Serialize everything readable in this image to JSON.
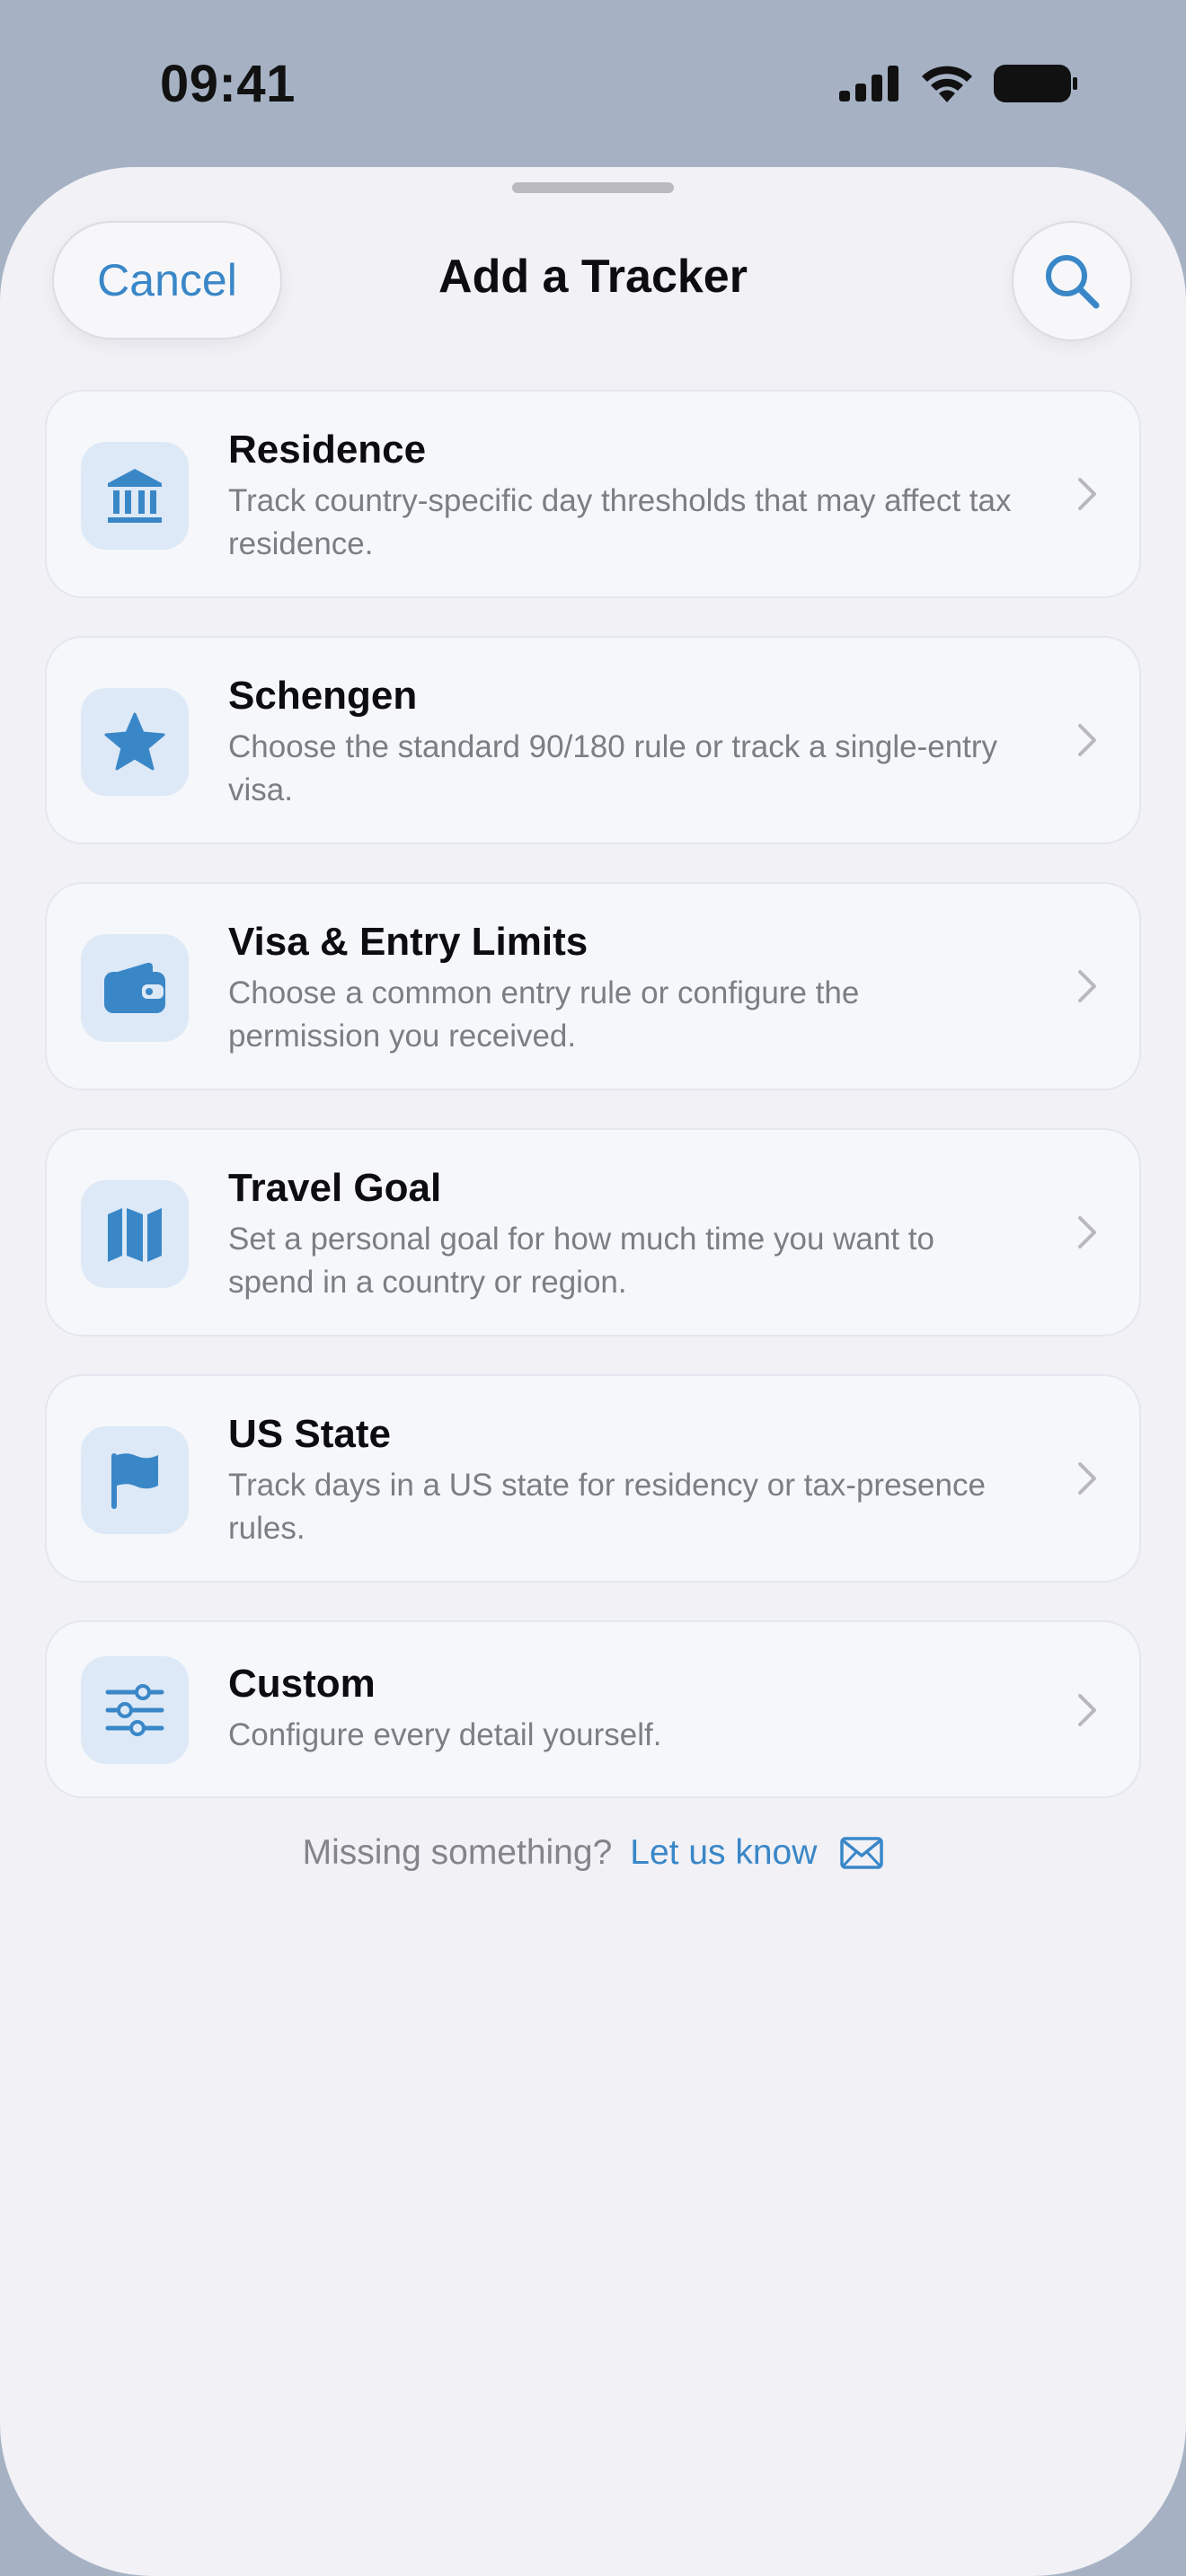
{
  "status_bar": {
    "time": "09:41"
  },
  "sheet": {
    "title": "Add a Tracker",
    "cancel_label": "Cancel"
  },
  "trackers": [
    {
      "title": "Residence",
      "description": "Track country-specific day thresholds that may affect tax residence.",
      "icon": "bank-icon"
    },
    {
      "title": "Schengen",
      "description": "Choose the standard 90/180 rule or track a single-entry visa.",
      "icon": "star-icon"
    },
    {
      "title": "Visa & Entry Limits",
      "description": "Choose a common entry rule or configure the permission you received.",
      "icon": "wallet-icon"
    },
    {
      "title": "Travel Goal",
      "description": "Set a personal goal for how much time you want to spend in a country or region.",
      "icon": "map-icon"
    },
    {
      "title": "US State",
      "description": "Track days in a US state for residency or tax-presence rules.",
      "icon": "flag-icon"
    },
    {
      "title": "Custom",
      "description": "Configure every detail yourself.",
      "icon": "sliders-icon"
    }
  ],
  "footer": {
    "text": "Missing something?",
    "link": "Let us know"
  },
  "colors": {
    "accent": "#3a87c8",
    "icon_bg": "#dde9f6",
    "sheet_bg": "#f1f1f6",
    "card_bg": "#f5f7fb"
  }
}
